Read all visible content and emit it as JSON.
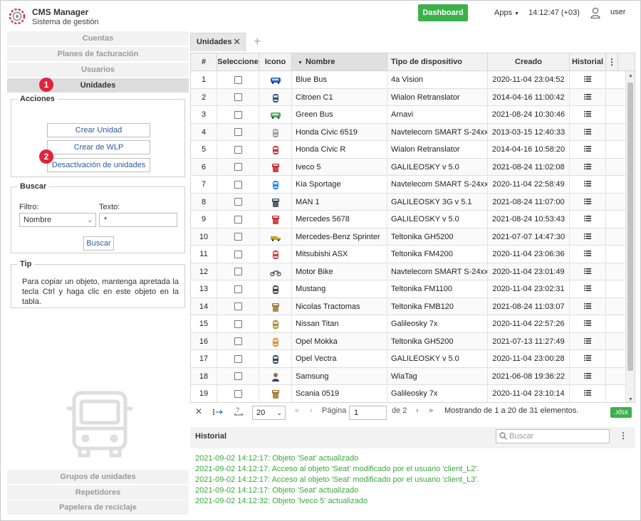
{
  "header": {
    "title": "CMS Manager",
    "subtitle": "Sistema de gestión",
    "dashboard_label": "Dashboard",
    "apps_label": "Apps",
    "time": "14:12:47 (+03)",
    "user": "user",
    "accent_color": "#3cb14a"
  },
  "sidebar": {
    "nav_top": [
      "Cuentas",
      "Planes de facturación",
      "Usuarios",
      "Unidades"
    ],
    "active_item": "Unidades",
    "badges": [
      "1",
      "2"
    ],
    "acciones": {
      "legend": "Acciones",
      "buttons": [
        "Crear Unidad",
        "Crear de WLP",
        "Desactivación de unidades"
      ]
    },
    "buscar": {
      "legend": "Buscar",
      "filter_label": "Filtro:",
      "filter_value": "Nombre",
      "text_label": "Texto:",
      "text_value": "*",
      "button": "Buscar"
    },
    "tip": {
      "legend": "Tip",
      "text": "Para copiar un objeto, mantenga apretada la tecla Ctrl y haga clic en este objeto en la tabla."
    },
    "nav_bottom": [
      "Grupos de unidades",
      "Repetidores",
      "Papelera de reciclaje"
    ]
  },
  "tabs": {
    "active": "Unidades",
    "add_label": "+"
  },
  "table": {
    "headers": [
      "#",
      "Seleccione",
      "Icono",
      "Nombre",
      "Tipo de dispositivo",
      "Creado",
      "Historial"
    ],
    "rows": [
      {
        "n": "1",
        "name": "Blue Bus",
        "device": "4a Vision",
        "created": "2020-11-04 23:04:52",
        "icon": "bus-icon",
        "color": "#2d62c8"
      },
      {
        "n": "2",
        "name": "Citroen C1",
        "device": "Wialon Retranslator",
        "created": "2014-04-16 11:00:42",
        "icon": "car-icon",
        "color": "#3b4a78"
      },
      {
        "n": "3",
        "name": "Green Bus",
        "device": "Arnavi",
        "created": "2021-08-24 10:30:46",
        "icon": "bus-icon",
        "color": "#4caf50"
      },
      {
        "n": "4",
        "name": "Honda Civic 6519",
        "device": "Navtelecom SMART S-24xx",
        "created": "2013-03-15 12:40:33",
        "icon": "car-icon",
        "color": "#9e9e9e"
      },
      {
        "n": "5",
        "name": "Honda Civic R",
        "device": "Wialon Retranslator",
        "created": "2014-04-16 10:58:20",
        "icon": "car-icon",
        "color": "#d32f2f"
      },
      {
        "n": "6",
        "name": "Iveco 5",
        "device": "GALILEOSKY v 5.0",
        "created": "2021-08-24 11:02:08",
        "icon": "truck-icon",
        "color": "#c62828"
      },
      {
        "n": "7",
        "name": "Kia Sportage",
        "device": "Navtelecom SMART S-24xx",
        "created": "2020-11-04 22:58:49",
        "icon": "car-icon",
        "color": "#1e88e5"
      },
      {
        "n": "8",
        "name": "MAN 1",
        "device": "GALILEOSKY 3G v 5.1",
        "created": "2021-08-24 11:07:00",
        "icon": "truck-icon",
        "color": "#37474f"
      },
      {
        "n": "9",
        "name": "Mercedes 5678",
        "device": "GALILEOSKY v 5.0",
        "created": "2021-08-24 10:53:43",
        "icon": "truck-icon",
        "color": "#c62828"
      },
      {
        "n": "10",
        "name": "Mercedes-Benz Sprinter",
        "device": "Teltonika GH5200",
        "created": "2021-07-07 14:47:30",
        "icon": "van-icon",
        "color": "#c9a227"
      },
      {
        "n": "11",
        "name": "Mitsubishi ASX",
        "device": "Teltonika FM4200",
        "created": "2020-11-04 23:06:36",
        "icon": "car-icon",
        "color": "#e53935"
      },
      {
        "n": "12",
        "name": "Motor Bike",
        "device": "Navtelecom SMART S-24xx",
        "created": "2020-11-04 23:01:49",
        "icon": "motorbike-icon",
        "color": "#555555"
      },
      {
        "n": "13",
        "name": "Mustang",
        "device": "Teltonika FM1100",
        "created": "2020-11-04 23:02:31",
        "icon": "car-icon",
        "color": "#424242"
      },
      {
        "n": "14",
        "name": "Nicolas Tractomas",
        "device": "Teltonika FMB120",
        "created": "2021-08-24 11:03:07",
        "icon": "truck-icon",
        "color": "#a0772a"
      },
      {
        "n": "15",
        "name": "Nissan Titan",
        "device": "Galileosky 7x",
        "created": "2020-11-04 22:57:26",
        "icon": "car-icon",
        "color": "#c08a1e"
      },
      {
        "n": "16",
        "name": "Opel Mokka",
        "device": "Teltonika GH5200",
        "created": "2021-07-13 11:27:49",
        "icon": "car-icon",
        "color": "#ef8c17"
      },
      {
        "n": "17",
        "name": "Opel Vectra",
        "device": "GALILEOSKY v 5.0",
        "created": "2020-11-04 23:00:28",
        "icon": "car-icon",
        "color": "#37474f"
      },
      {
        "n": "18",
        "name": "Samsung",
        "device": "WiaTag",
        "created": "2021-06-08 19:36:22",
        "icon": "person-icon",
        "color": "#8d6e63"
      },
      {
        "n": "19",
        "name": "Scania 0519",
        "device": "Galileosky 7x",
        "created": "2020-11-04 23:10:14",
        "icon": "truck-icon",
        "color": "#a0772a"
      }
    ]
  },
  "pager": {
    "page_size": "20",
    "page_label": "Página",
    "page_value": "1",
    "of_label": "de 2",
    "summary": "Mostrando de 1 a 20 de 31 elementos.",
    "export_label": ".xlsx"
  },
  "historial": {
    "title": "Historial",
    "search_placeholder": "Buscar",
    "log": [
      "2021-09-02 14:12:17: Objeto 'Seat' actualizado",
      "2021-09-02 14:12:17: Acceso al objeto 'Seat' modificado por el usuario 'client_L2'.",
      "2021-09-02 14:12:17: Acceso al objeto 'Seat' modificado por el usuario 'client_L3'.",
      "2021-09-02 14:12:17: Objeto 'Seat' actualizado",
      "2021-09-02 14:12:32: Objeto 'Iveco 5' actualizado"
    ]
  }
}
